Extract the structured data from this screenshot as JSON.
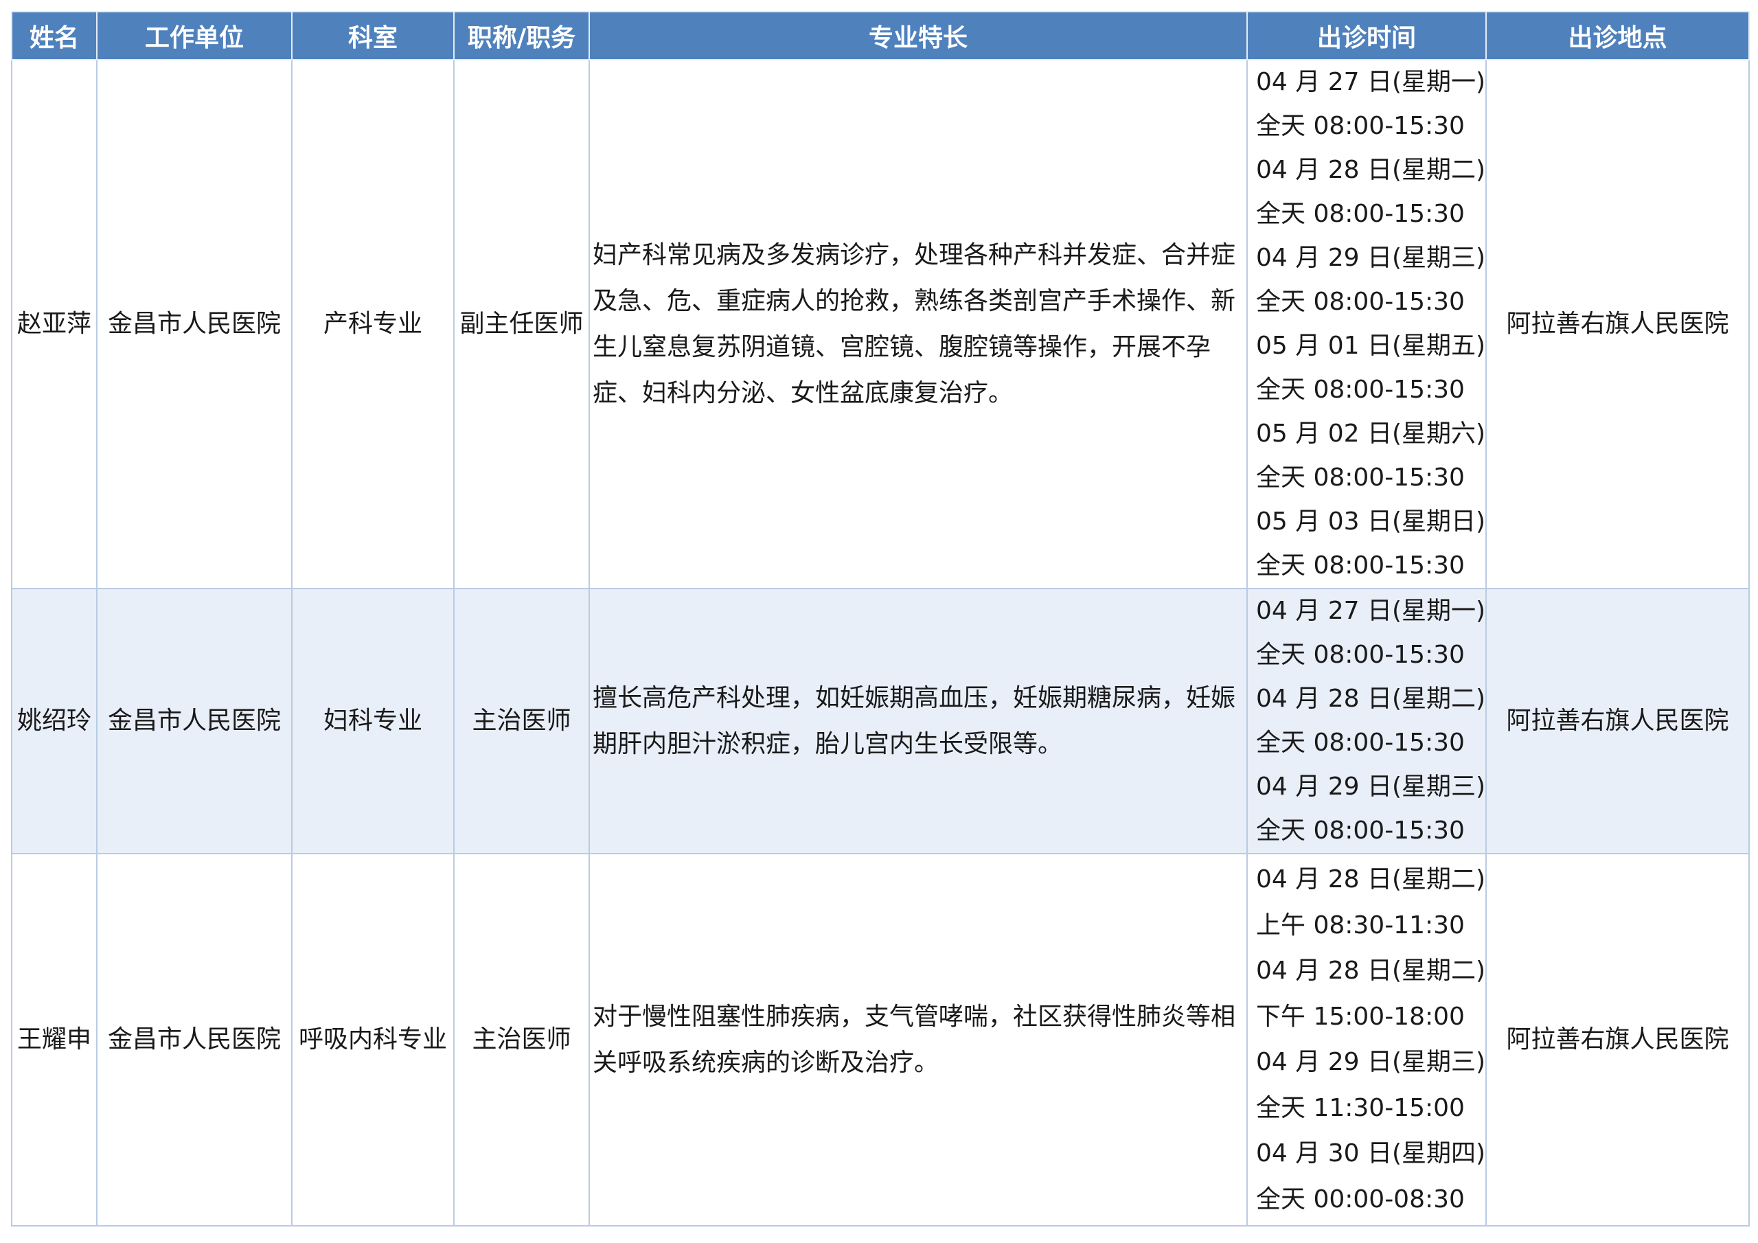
{
  "table": {
    "headers": [
      "姓名",
      "工作单位",
      "科室",
      "职称/职务",
      "专业特长",
      "出诊时间",
      "出诊地点"
    ],
    "rows": [
      {
        "name": "赵亚萍",
        "unit": "金昌市人民医院",
        "dept": "产科专业",
        "title": "副主任医师",
        "specialty": "妇产科常见病及多发病诊疗，处理各种产科并发症、合并症及急、危、重症病人的抢救，熟练各类剖宫产手术操作、新生儿窒息复苏阴道镜、宫腔镜、腹腔镜等操作，开展不孕症、妇科内分泌、女性盆底康复治疗。",
        "specialty_lines": [
          "妇产科常见病及多发病诊疗，处理各种产科并发症、合并症",
          "及急、危、重症病人的抢救，熟练各类剖宫产手术操作、新",
          "生儿窒息复苏阴道镜、宫腔镜、腹腔镜等操作，开展不孕",
          "症、妇科内分泌、女性盆底康复治疗。"
        ],
        "times": [
          "04 月 27 日(星期一)",
          "全天 08:00-15:30",
          "04 月 28 日(星期二)",
          "全天 08:00-15:30",
          "04 月 29 日(星期三)",
          "全天 08:00-15:30",
          "05 月 01 日(星期五)",
          "全天 08:00-15:30",
          "05 月 02 日(星期六)",
          "全天 08:00-15:30",
          "05 月 03 日(星期日)",
          "全天 08:00-15:30"
        ],
        "location": "阿拉善右旗人民医院"
      },
      {
        "name": "姚绍玲",
        "unit": "金昌市人民医院",
        "dept": "妇科专业",
        "title": "主治医师",
        "specialty_lines": [
          "擅长高危产科处理，如妊娠期高血压，妊娠期糖尿病，妊娠",
          "期肝内胆汁淤积症，胎儿宫内生长受限等。"
        ],
        "times": [
          "04 月 27 日(星期一)",
          "全天 08:00-15:30",
          "04 月 28 日(星期二)",
          "全天 08:00-15:30",
          "04 月 29 日(星期三)",
          "全天 08:00-15:30"
        ],
        "location": "阿拉善右旗人民医院"
      },
      {
        "name": "王耀申",
        "unit": "金昌市人民医院",
        "dept": "呼吸内科专业",
        "title": "主治医师",
        "specialty_lines": [
          "对于慢性阻塞性肺疾病，支气管哮喘，社区获得性肺炎等相",
          "关呼吸系统疾病的诊断及治疗。"
        ],
        "times": [
          "04 月 28 日(星期二)",
          "上午 08:30-11:30",
          "04 月 28 日(星期二)",
          "下午 15:00-18:00",
          "04 月 29 日(星期三)",
          "全天 11:30-15:00",
          "04 月 30 日(星期四)",
          "全天 00:00-08:30"
        ],
        "location": "阿拉善右旗人民医院"
      }
    ]
  },
  "colors": {
    "header_bg": "#4f81bd",
    "header_text": "#ffffff",
    "alt_row_bg": "#e9eff8",
    "border": "#b9cbe4"
  }
}
